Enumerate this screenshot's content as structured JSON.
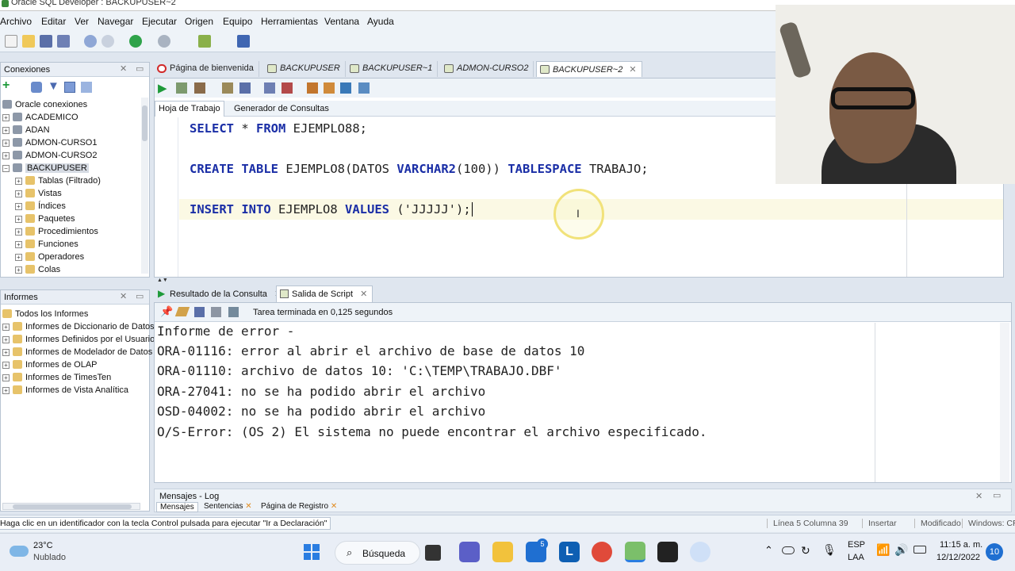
{
  "window": {
    "title": "Oracle SQL Developer : BACKUPUSER~2"
  },
  "menu": [
    "Archivo",
    "Editar",
    "Ver",
    "Navegar",
    "Ejecutar",
    "Origen",
    "Equipo",
    "Herramientas",
    "Ventana",
    "Ayuda"
  ],
  "connections": {
    "title": "Conexiones",
    "root": "Oracle conexiones",
    "items": [
      "ACADEMICO",
      "ADAN",
      "ADMON-CURSO1",
      "ADMON-CURSO2",
      "BACKUPUSER"
    ],
    "children": [
      "Tablas (Filtrado)",
      "Vistas",
      "Índices",
      "Paquetes",
      "Procedimientos",
      "Funciones",
      "Operadores",
      "Colas"
    ]
  },
  "reports": {
    "title": "Informes",
    "items": [
      "Todos los Informes",
      "Informes de Diccionario de Datos",
      "Informes Definidos por el Usuario",
      "Informes de Modelador de Datos",
      "Informes de OLAP",
      "Informes de TimesTen",
      "Informes de Vista Analítica"
    ]
  },
  "editor_tabs": [
    "Página de bienvenida",
    "BACKUPUSER",
    "BACKUPUSER~1",
    "ADMON-CURSO2",
    "BACKUPUSER~2"
  ],
  "sub_tabs": [
    "Hoja de Trabajo",
    "Generador de Consultas"
  ],
  "code": {
    "l1": {
      "kw1": "SELECT",
      "star": " * ",
      "kw2": "FROM",
      "rest": " EJEMPLO88;"
    },
    "l2": {
      "kw1": "CREATE",
      "sp": " ",
      "kw2": "TABLE",
      "mid": " EJEMPLO8(DATOS ",
      "kw3": "VARCHAR2",
      "args": "(100)) ",
      "kw4": "TABLESPACE",
      "rest": " TRABAJO;"
    },
    "l3": {
      "kw1": "INSERT",
      "sp": " ",
      "kw2": "INTO",
      "mid": " EJEMPLO8 ",
      "kw3": "VALUES",
      "rest": " ('JJJJJ');"
    }
  },
  "result_tabs": [
    "Resultado de la Consulta",
    "Salida de Script"
  ],
  "task_status": "Tarea terminada en 0,125 segundos",
  "output_lines": [
    "Informe de error -",
    "ORA-01116: error al abrir el archivo de base de datos 10",
    "ORA-01110: archivo de datos 10: 'C:\\TEMP\\TRABAJO.DBF'",
    "ORA-27041: no se ha podido abrir el archivo",
    "OSD-04002: no se ha podido abrir el archivo",
    "O/S-Error: (OS 2) El sistema no puede encontrar el archivo especificado."
  ],
  "messages": {
    "title": "Mensajes - Log",
    "tabs": [
      "Mensajes",
      "Sentencias",
      "Página de Registro"
    ]
  },
  "statusbar": {
    "hint": "Haga clic en un identificador con la tecla Control pulsada para ejecutar \"Ir a Declaración\"",
    "position": "Línea 5 Columna 39",
    "mode": "Insertar",
    "state": "Modificado",
    "eol": "Windows: CR"
  },
  "taskbar": {
    "temp": "23°C",
    "weather": "Nublado",
    "search": "Búsqueda",
    "lang1": "ESP",
    "lang2": "LAA",
    "time": "11:15 a. m.",
    "date": "12/12/2022",
    "notif": "10",
    "badge": "5"
  }
}
